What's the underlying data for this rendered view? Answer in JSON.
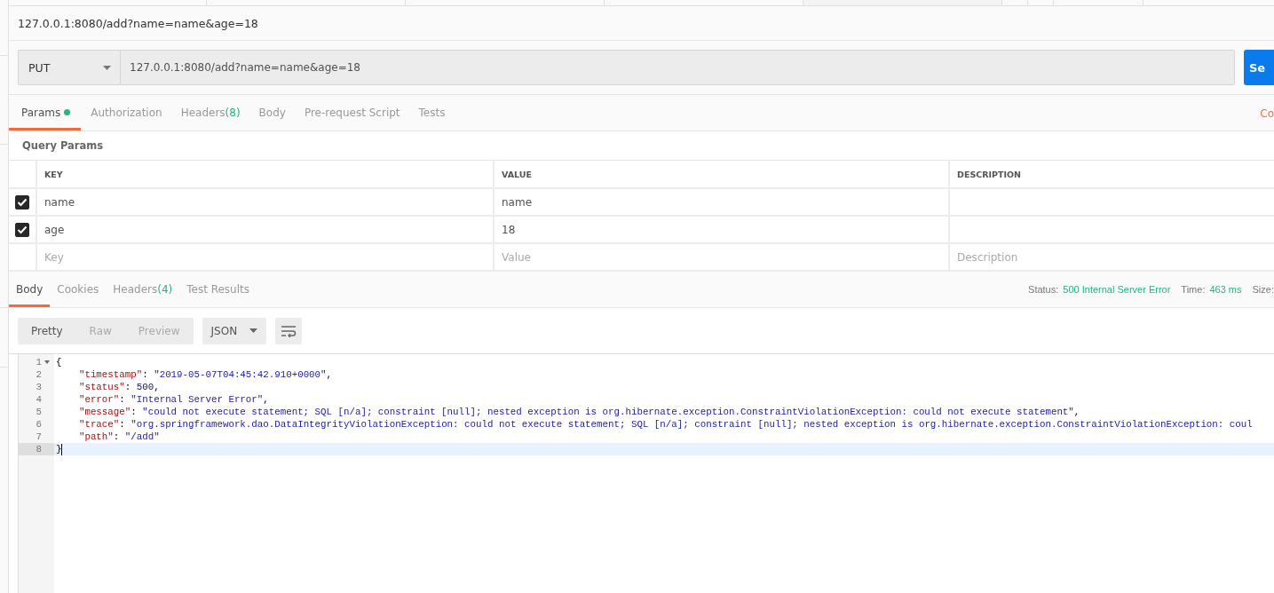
{
  "request_title": "127.0.0.1:8080/add?name=name&age=18",
  "request": {
    "method": "PUT",
    "url": "127.0.0.1:8080/add?name=name&age=18",
    "send_label": "Se"
  },
  "request_tabs": [
    {
      "label": "Params",
      "dot": true,
      "selected": true
    },
    {
      "label": "Authorization",
      "dot": false,
      "selected": false
    },
    {
      "label": "Headers",
      "count": "(8)",
      "dot": false,
      "selected": false
    },
    {
      "label": "Body",
      "dot": false,
      "selected": false
    },
    {
      "label": "Pre-request Script",
      "dot": false,
      "selected": false
    },
    {
      "label": "Tests",
      "dot": false,
      "selected": false
    }
  ],
  "cookies_link": "Co",
  "query_params": {
    "title": "Query Params",
    "columns": [
      "KEY",
      "VALUE",
      "DESCRIPTION"
    ],
    "rows": [
      {
        "checked": true,
        "key": "name",
        "value": "name",
        "description": ""
      },
      {
        "checked": true,
        "key": "age",
        "value": "18",
        "description": ""
      }
    ],
    "new_row": {
      "key": {
        "placeholder": "Key"
      },
      "value": {
        "placeholder": "Value"
      },
      "description": {
        "placeholder": "Description"
      }
    }
  },
  "response_tabs": [
    {
      "label": "Body",
      "selected": true
    },
    {
      "label": "Cookies",
      "selected": false
    },
    {
      "label": "Headers",
      "count": "(4)",
      "selected": false
    },
    {
      "label": "Test Results",
      "selected": false
    }
  ],
  "response_meta": [
    {
      "label": "Status:",
      "value": "500 Internal Server Error"
    },
    {
      "label": "Time:",
      "value": "463 ms"
    },
    {
      "label": "Size:"
    }
  ],
  "view_modes": [
    {
      "label": "Pretty",
      "selected": true
    },
    {
      "label": "Raw",
      "selected": false
    },
    {
      "label": "Preview",
      "selected": false
    }
  ],
  "format": "JSON",
  "code_lines": [
    {
      "number": "1",
      "fold": true,
      "current": false,
      "segments": [
        {
          "kind": "punct",
          "text": "{"
        }
      ]
    },
    {
      "number": "2",
      "fold": false,
      "current": false,
      "segments": [
        {
          "kind": "key",
          "text": "    \"timestamp\""
        },
        {
          "kind": "punct",
          "text": ": "
        },
        {
          "kind": "string",
          "text": "\"2019-05-07T04:45:42.910+0000\""
        },
        {
          "kind": "punct",
          "text": ","
        }
      ]
    },
    {
      "number": "3",
      "fold": false,
      "current": false,
      "segments": [
        {
          "kind": "key",
          "text": "    \"status\""
        },
        {
          "kind": "punct",
          "text": ": "
        },
        {
          "kind": "number",
          "text": "500"
        },
        {
          "kind": "punct",
          "text": ","
        }
      ]
    },
    {
      "number": "4",
      "fold": false,
      "current": false,
      "segments": [
        {
          "kind": "key",
          "text": "    \"error\""
        },
        {
          "kind": "punct",
          "text": ": "
        },
        {
          "kind": "string",
          "text": "\"Internal Server Error\""
        },
        {
          "kind": "punct",
          "text": ","
        }
      ]
    },
    {
      "number": "5",
      "fold": false,
      "current": false,
      "segments": [
        {
          "kind": "key",
          "text": "    \"message\""
        },
        {
          "kind": "punct",
          "text": ": "
        },
        {
          "kind": "string",
          "text": "\"could not execute statement; SQL [n/a]; constraint [null]; nested exception is org.hibernate.exception.ConstraintViolationException: could not execute statement\""
        },
        {
          "kind": "punct",
          "text": ","
        }
      ]
    },
    {
      "number": "6",
      "fold": false,
      "current": false,
      "segments": [
        {
          "kind": "key",
          "text": "    \"trace\""
        },
        {
          "kind": "punct",
          "text": ": "
        },
        {
          "kind": "string",
          "text": "\"org.springframework.dao.DataIntegrityViolationException: could not execute statement; SQL [n/a]; constraint [null]; nested exception is org.hibernate.exception.ConstraintViolationException: coul"
        }
      ]
    },
    {
      "number": "7",
      "fold": false,
      "current": false,
      "segments": [
        {
          "kind": "key",
          "text": "    \"path\""
        },
        {
          "kind": "punct",
          "text": ": "
        },
        {
          "kind": "string",
          "text": "\"/add\""
        }
      ]
    },
    {
      "number": "8",
      "fold": false,
      "current": true,
      "segments": [
        {
          "kind": "punct",
          "text": "}"
        }
      ]
    }
  ]
}
